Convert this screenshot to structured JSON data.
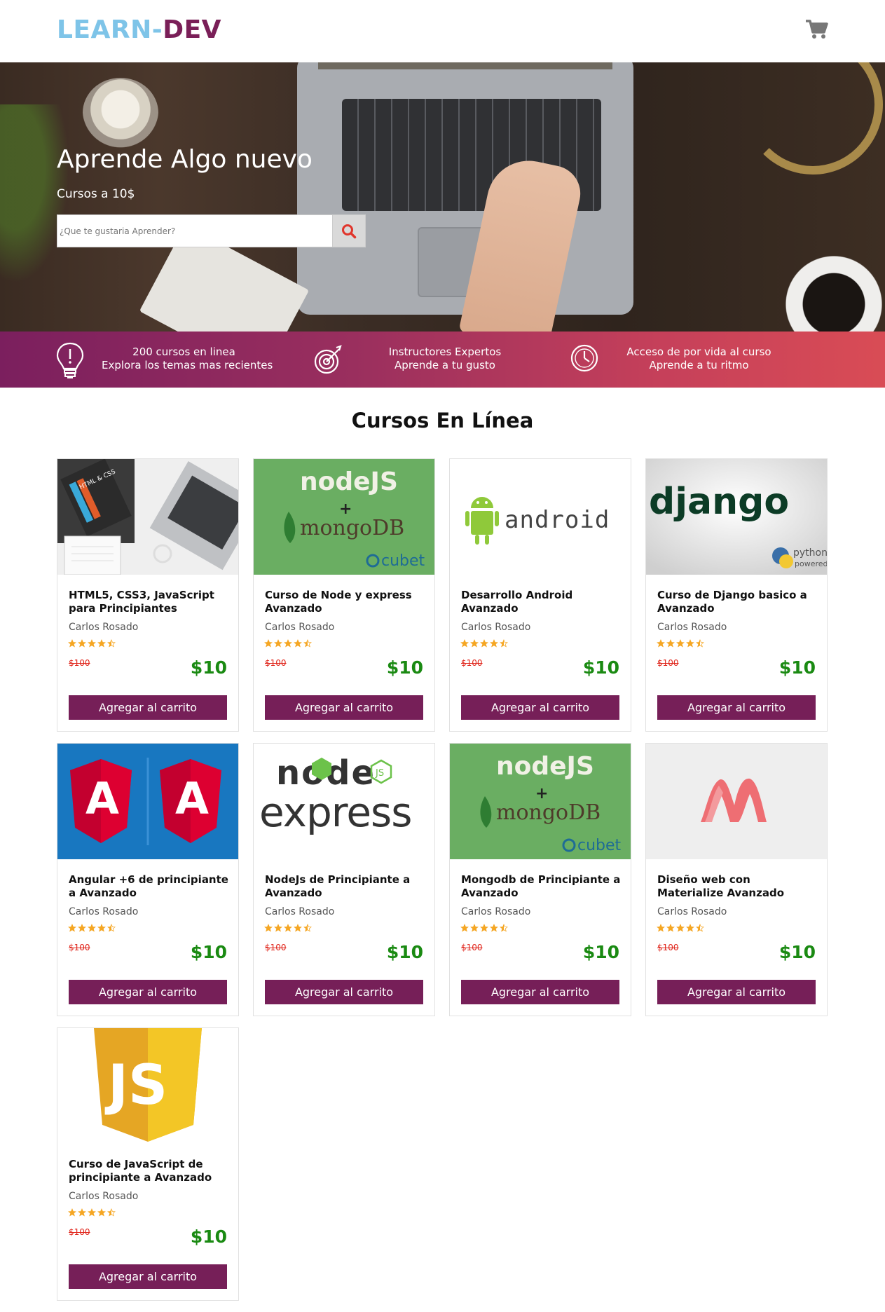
{
  "header": {
    "logo_part1": "LEARN-",
    "logo_part2": "DEV",
    "cart_icon": "shopping-cart-icon"
  },
  "hero": {
    "title": "Aprende Algo nuevo",
    "subtitle": "Cursos a 10$",
    "search_placeholder": "¿Que te gustaria Aprender?",
    "search_icon": "search-icon"
  },
  "features": [
    {
      "icon": "lightbulb-icon",
      "line1": "200 cursos en linea",
      "line2": "Explora los temas mas recientes"
    },
    {
      "icon": "target-icon",
      "line1": "Instructores Expertos",
      "line2": "Aprende a tu gusto"
    },
    {
      "icon": "clock-icon",
      "line1": "Acceso de por vida al curso",
      "line2": "Aprende a tu ritmo"
    }
  ],
  "section_title": "Cursos En Línea",
  "courses": [
    {
      "title": "HTML5, CSS3, JavaScript para Principiantes",
      "author": "Carlos Rosado",
      "old_price": "$100",
      "price": "$10",
      "button": "Agregar al carrito",
      "rating": 4.5,
      "image": "html-css-books"
    },
    {
      "title": "Curso de Node y express Avanzado",
      "author": "Carlos Rosado",
      "old_price": "$100",
      "price": "$10",
      "button": "Agregar al carrito",
      "rating": 4.5,
      "image": "nodejs-mongodb"
    },
    {
      "title": "Desarrollo Android Avanzado",
      "author": "Carlos Rosado",
      "old_price": "$100",
      "price": "$10",
      "button": "Agregar al carrito",
      "rating": 4.5,
      "image": "android"
    },
    {
      "title": "Curso de Django basico a Avanzado",
      "author": "Carlos Rosado",
      "old_price": "$100",
      "price": "$10",
      "button": "Agregar al carrito",
      "rating": 4.5,
      "image": "django"
    },
    {
      "title": "Angular +6 de principiante a Avanzado",
      "author": "Carlos Rosado",
      "old_price": "$100",
      "price": "$10",
      "button": "Agregar al carrito",
      "rating": 4.5,
      "image": "angular"
    },
    {
      "title": "NodeJs de Principiante a Avanzado",
      "author": "Carlos Rosado",
      "old_price": "$100",
      "price": "$10",
      "button": "Agregar al carrito",
      "rating": 4.5,
      "image": "node-express"
    },
    {
      "title": "Mongodb de Principiante a Avanzado",
      "author": "Carlos Rosado",
      "old_price": "$100",
      "price": "$10",
      "button": "Agregar al carrito",
      "rating": 4.5,
      "image": "nodejs-mongodb"
    },
    {
      "title": "Diseño web con Materialize Avanzado",
      "author": "Carlos Rosado",
      "old_price": "$100",
      "price": "$10",
      "button": "Agregar al carrito",
      "rating": 4.5,
      "image": "materialize"
    },
    {
      "title": "Curso de JavaScript de principiante a Avanzado",
      "author": "Carlos Rosado",
      "old_price": "$100",
      "price": "$10",
      "button": "Agregar al carrito",
      "rating": 4.5,
      "image": "javascript"
    }
  ],
  "logo_texts": {
    "nodejs": "nodeJS",
    "plus": "+",
    "mongodb": "mongoDB",
    "cubet": "cubet",
    "android": "android",
    "django": "django",
    "python": "python",
    "powered": "powered",
    "html_book": "HTML & CSS",
    "node": "node",
    "js_badge": "JS",
    "express": "express",
    "angular_a": "A",
    "js": "JS"
  },
  "colors": {
    "accent": "#761f58",
    "logo_light": "#7ec4e8",
    "logo_dark": "#7a1f58",
    "price_green": "#1a8a12",
    "old_price_red": "#e0251b",
    "star": "#f5a623"
  }
}
